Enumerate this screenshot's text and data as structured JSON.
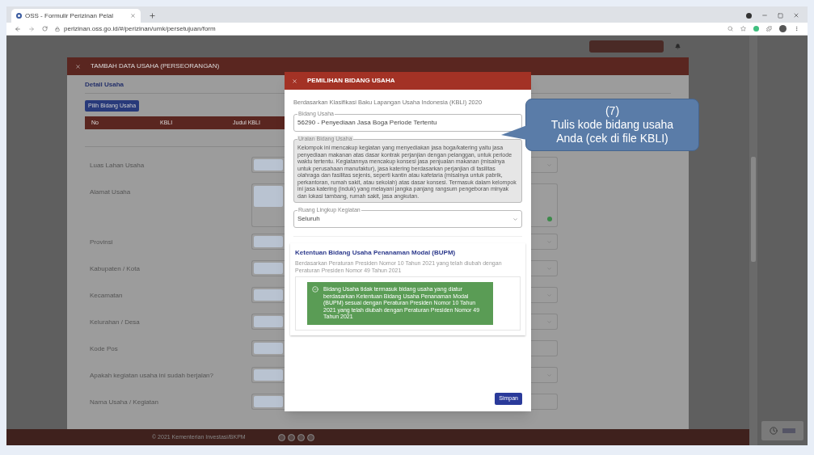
{
  "browser": {
    "tab_title": "OSS - Formulir Perizinan Pelal",
    "url": "perizinan.oss.go.id/#/perizinan/umk/persetujuan/form"
  },
  "outer_modal": {
    "title": "TAMBAH DATA USAHA (PERSEORANGAN)",
    "section_title": "Detail Usaha",
    "pick_button": "Pilih Bidang Usaha",
    "table_columns": [
      "No",
      "KBLI",
      "Judul KBLI"
    ],
    "form_fields": [
      {
        "label": "Luas Lahan Usaha",
        "kind": "select"
      },
      {
        "label": "Alamat Usaha",
        "kind": "textarea"
      },
      {
        "label": "Provinsi",
        "kind": "select"
      },
      {
        "label": "Kabupaten / Kota",
        "kind": "select"
      },
      {
        "label": "Kecamatan",
        "kind": "select"
      },
      {
        "label": "Kelurahan / Desa",
        "kind": "select"
      },
      {
        "label": "Kode Pos",
        "kind": "text"
      },
      {
        "label": "Apakah kegiatan usaha ini sudah berjalan?",
        "kind": "select"
      },
      {
        "label": "Nama Usaha / Kegiatan",
        "kind": "text"
      }
    ],
    "footer": "© 2021 Kementerian Investasi/BKPM"
  },
  "dialog": {
    "title": "PEMILIHAN BIDANG USAHA",
    "subtitle": "Berdasarkan Klasifikasi Baku Lapangan Usaha Indonesia (KBLI) 2020",
    "fields": [
      {
        "label": "Bidang Usaha",
        "value": "56290 - Penyediaan Jasa Boga Periode Tertentu",
        "kind": "text"
      },
      {
        "label": "Uraian Bidang Usaha",
        "value": "Kelompok ini mencakup kegiatan yang menyediakan jasa boga/katering yaitu jasa penyediaan makanan atas dasar kontrak perjanjian dengan pelanggan, untuk periode waktu tertentu. Kegiatannya mencakup konsesi jasa penjualan makanan (misalnya untuk perusahaan manufaktur), jasa katering berdasarkan perjanjian di fasilitas olahraga dan fasilitas sejenis, seperti kantin atau kafetaria (misalnya untuk pabrik, perkantoran, rumah sakit, atau sekolah) atas dasar konsesi. Termasuk dalam kelompok ini jasa katering (induk) yang melayani jangka panjang rangsum pengeboran minyak dan lokasi tambang, rumah sakit, jasa angkutan.",
        "kind": "textarea"
      },
      {
        "label": "Ruang Lingkup Kegiatan",
        "value": "Seluruh",
        "kind": "select"
      }
    ],
    "bupm": {
      "title": "Ketentuan Bidang Usaha Penanaman Modal (BUPM)",
      "subtitle": "Berdasarkan Peraturan Presiden Nomor 10 Tahun 2021 yang telah diubah dengan Peraturan Presiden Nomor 49 Tahun 2021",
      "notice": "Bidang Usaha tidak termasuk bidang usaha yang diatur berdasarkan Ketentuan Bidang Usaha Penanaman Modal (BUPM) sesuai dengan Peraturan Presiden Nomor 10 Tahun 2021 yang telah diubah dengan Peraturan Presiden Nomor 49 Tahun 2021"
    },
    "save_button": "Simpan"
  },
  "callout": {
    "lines": [
      "(7)",
      "Tulis kode bidang usaha",
      "Anda (cek di file KBLI)"
    ]
  }
}
